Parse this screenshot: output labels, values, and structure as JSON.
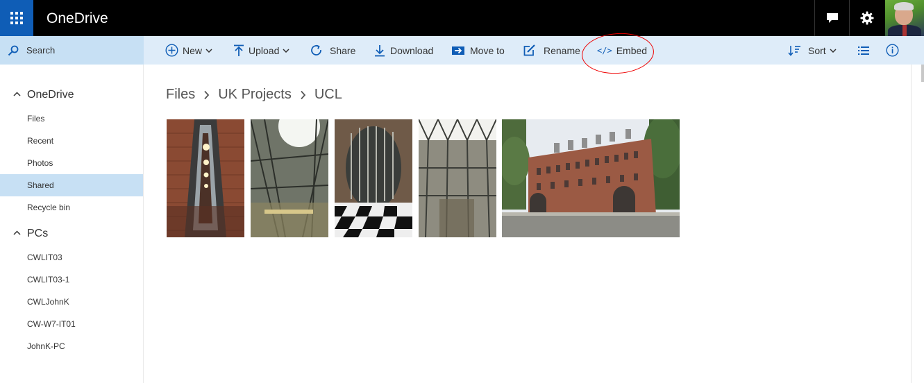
{
  "app": {
    "title": "OneDrive"
  },
  "search": {
    "placeholder": "Search"
  },
  "commands": {
    "new": "New",
    "upload": "Upload",
    "share": "Share",
    "download": "Download",
    "move_to": "Move to",
    "rename": "Rename",
    "embed": "Embed",
    "sort": "Sort"
  },
  "sidebar": {
    "onedrive_header": "OneDrive",
    "items": [
      "Files",
      "Recent",
      "Photos",
      "Shared",
      "Recycle bin"
    ],
    "active_item": "Shared",
    "pcs_header": "PCs",
    "pcs": [
      "CWLIT03",
      "CWLIT03-1",
      "CWLJohnK",
      "CW-W7-IT01",
      "JohnK-PC"
    ]
  },
  "breadcrumb": [
    "Files",
    "UK Projects",
    "UCL"
  ],
  "photos": [
    {
      "name": "photo-brick-atrium-lights"
    },
    {
      "name": "photo-glass-atrium-skylight"
    },
    {
      "name": "photo-checkered-floor-rotunda"
    },
    {
      "name": "photo-glass-facets-atrium"
    },
    {
      "name": "photo-ucl-building-exterior"
    }
  ],
  "colors": {
    "topbar": "#000000",
    "waffle": "#0f5db6",
    "command_bar": "#deecf9",
    "selected": "#c7e0f4",
    "accent": "#0f5db6",
    "annotation": "#ee0000"
  },
  "icons": {
    "app_launcher": "waffle-icon",
    "feedback": "feedback-icon",
    "settings": "gear-icon",
    "search": "search-icon",
    "new": "plus-circle-icon",
    "upload": "upload-arrow-icon",
    "share": "share-icon",
    "download": "download-arrow-icon",
    "move_to": "move-to-icon",
    "rename": "rename-icon",
    "embed": "code-icon",
    "sort": "sort-icon",
    "view": "list-view-icon",
    "info": "info-icon"
  }
}
